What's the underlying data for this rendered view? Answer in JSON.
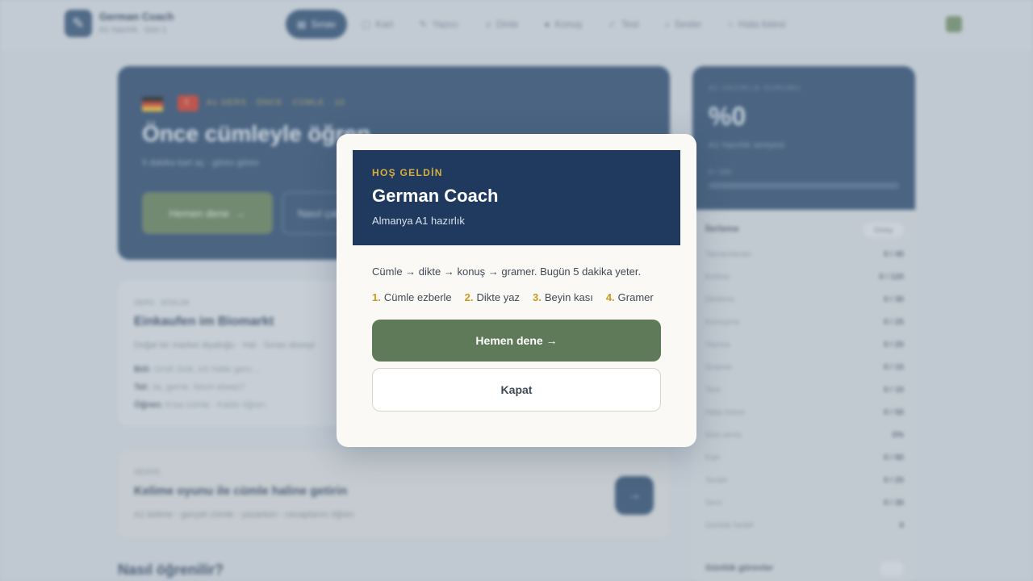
{
  "background": {
    "brand": {
      "icon": "app-logo-icon",
      "name": "German Coach",
      "subtitle": "A1 hazırlık · Gün 1"
    },
    "nav": [
      {
        "label": "Sınav",
        "icon": "exam-icon",
        "active": true
      },
      {
        "label": "Kart",
        "icon": "card-icon",
        "active": false
      },
      {
        "label": "Yazıcı",
        "icon": "pen-icon",
        "active": false
      },
      {
        "label": "Dinle",
        "icon": "headphones-icon",
        "active": false
      },
      {
        "label": "Konuş",
        "icon": "mic-icon",
        "active": false
      },
      {
        "label": "Test",
        "icon": "check-icon",
        "active": false
      },
      {
        "label": "Sesler",
        "icon": "sound-icon",
        "active": false
      },
      {
        "label": "Hata listesi",
        "icon": "list-icon",
        "active": false
      }
    ],
    "hero": {
      "meta": "A1 DERS · ÖNCE · CÜMLE · 10",
      "title": "Önce cümleyle öğren",
      "subtitle": "5 dakika kart aç · görev görev",
      "primary_button": "Hemen dene",
      "secondary_button": "Nasıl çalışır"
    },
    "card1": {
      "tag": "DERS · SÖZLÜK",
      "title": "Einkaufen im Biomarkt",
      "subtitle": "Doğal bir market diyaloğu · Hal · Sınav düzeyi",
      "lines": [
        {
          "key": "Böl:",
          "text": "Grüß Gott, ich hätte gern…"
        },
        {
          "key": "Tel:",
          "text": "Ja, gerne. Noch etwas?"
        },
        {
          "key": "Öğren:",
          "text": "Kısa cümle · Kalıbı öğren"
        }
      ]
    },
    "card2": {
      "tag": "SEVİYE",
      "title": "Kelime oyunu ile cümle haline getirin",
      "subtitle": "A1 kelime · gerçek cümle · yazarken · cevaplarını öğren"
    },
    "section_heading": "Nasıl öğrenilir?",
    "side": {
      "label": "A1 HAZIRLIK DURUMU",
      "percent": "%0",
      "note": "A1 hazırlık seviyesi",
      "bar_label": "0 / 100",
      "progress": 0,
      "list_title": "İlerleme",
      "list_chip": "Detay",
      "rows": [
        {
          "label": "Tamamlanan",
          "value": "0 / 40"
        },
        {
          "label": "Kelime",
          "value": "0 / 120"
        },
        {
          "label": "Dinleme",
          "value": "0 / 30"
        },
        {
          "label": "Konuşma",
          "value": "0 / 25"
        },
        {
          "label": "Yazma",
          "value": "0 / 20"
        },
        {
          "label": "Gramer",
          "value": "0 / 15"
        },
        {
          "label": "Test",
          "value": "0 / 10"
        },
        {
          "label": "Hata listesi",
          "value": "0 / 50"
        },
        {
          "label": "Gün serisi",
          "value": "0%"
        },
        {
          "label": "Kart",
          "value": "0 / 80"
        },
        {
          "label": "Sesler",
          "value": "0 / 20"
        },
        {
          "label": "Ders",
          "value": "0 / 30"
        },
        {
          "label": "Günlük hedef",
          "value": "0"
        }
      ],
      "footer_title": "Günlük görevler"
    }
  },
  "modal": {
    "kicker": "HOŞ GELDİN",
    "title": "German Coach",
    "subtitle": "Almanya A1 hazırlık",
    "intro": "Cümle → dikte → konuş → gramer. Bugün 5 dakika yeter.",
    "steps": [
      {
        "num": "1.",
        "label": "Cümle ezberle"
      },
      {
        "num": "2.",
        "label": "Dikte yaz"
      },
      {
        "num": "3.",
        "label": "Beyin kası"
      },
      {
        "num": "4.",
        "label": "Gramer"
      }
    ],
    "primary_button": "Hemen dene →",
    "secondary_button": "Kapat",
    "colors": {
      "header": "#1f3a5e",
      "accent": "#d8ad3c",
      "primary": "#5e7a58"
    }
  }
}
